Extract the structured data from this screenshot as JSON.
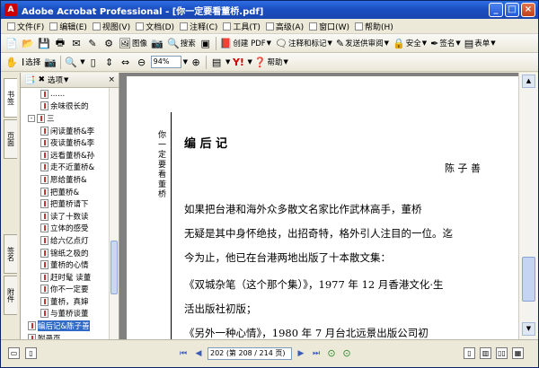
{
  "window": {
    "title": "Adobe Acrobat Professional - [你一定要看董桥.pdf]",
    "app_icon": "acrobat-icon",
    "buttons": [
      "_",
      "□",
      "×"
    ]
  },
  "menu": [
    {
      "label": "文件(F)"
    },
    {
      "label": "编辑(E)"
    },
    {
      "label": "视图(V)"
    },
    {
      "label": "文档(D)"
    },
    {
      "label": "注释(C)"
    },
    {
      "label": "工具(T)"
    },
    {
      "label": "高级(A)"
    },
    {
      "label": "窗口(W)"
    },
    {
      "label": "帮助(H)"
    }
  ],
  "toolbar1": {
    "pdf_image_label": "图像",
    "search_label": "搜索",
    "create_pdf_label": "创建 PDF",
    "comment_label": "注释和标记",
    "send_review_label": "发送供审阅",
    "secure_label": "安全",
    "sign_label": "签名",
    "forms_label": "表单"
  },
  "toolbar2": {
    "select_label": "选择",
    "zoom_value": "94%",
    "help_label": "帮助"
  },
  "nav": {
    "options_label": "选项",
    "close_label": "×",
    "tabs": [
      "书签",
      "页面",
      "签名",
      "附件",
      "注释"
    ],
    "tree": [
      {
        "label": "......",
        "indent": 1
      },
      {
        "label": "余味很长的",
        "indent": 1
      },
      {
        "label": "三",
        "indent": 0,
        "expander": "-"
      },
      {
        "label": "闲读董桥&李",
        "indent": 1
      },
      {
        "label": "夜读董桥&李",
        "indent": 1
      },
      {
        "label": "远看董桥&孙",
        "indent": 1
      },
      {
        "label": "走不近董桥&",
        "indent": 1
      },
      {
        "label": "愿给董桥&",
        "indent": 1
      },
      {
        "label": "把董桥&",
        "indent": 1
      },
      {
        "label": "把董桥请下",
        "indent": 1
      },
      {
        "label": "读了十数读",
        "indent": 1
      },
      {
        "label": "立体的感受",
        "indent": 1
      },
      {
        "label": "给六亿点灯",
        "indent": 1
      },
      {
        "label": "锦纸之极的",
        "indent": 1
      },
      {
        "label": "董桥的心情",
        "indent": 1
      },
      {
        "label": "赶时髦 读董",
        "indent": 1
      },
      {
        "label": "你不一定要",
        "indent": 1
      },
      {
        "label": "董桥，真婶",
        "indent": 1
      },
      {
        "label": "与董桥谈董",
        "indent": 1
      },
      {
        "label": "编后记&陈子善",
        "indent": 0,
        "selected": true
      },
      {
        "label": "附录页",
        "indent": 0
      }
    ]
  },
  "document": {
    "header_vertical": "你一定要看董桥",
    "title": "编 后 记",
    "author": "陈 子 善",
    "lines": [
      "    如果把台港和海外众多散文名家比作武林高手，董桥",
      "无疑是其中身怀绝技，出招奇特，格外引人注目的一位。迄",
      "今为止，他已在台港两地出版了十本散文集：",
      "    《双城杂笔（这个那个集）》，1977 年 12 月香港文化·生",
      "活出版社初版；",
      "    《另外一种心情》，1980 年 7 月台北远景出版公司初"
    ]
  },
  "statusbar": {
    "page_field": "202 (第 208 / 214 页)"
  }
}
